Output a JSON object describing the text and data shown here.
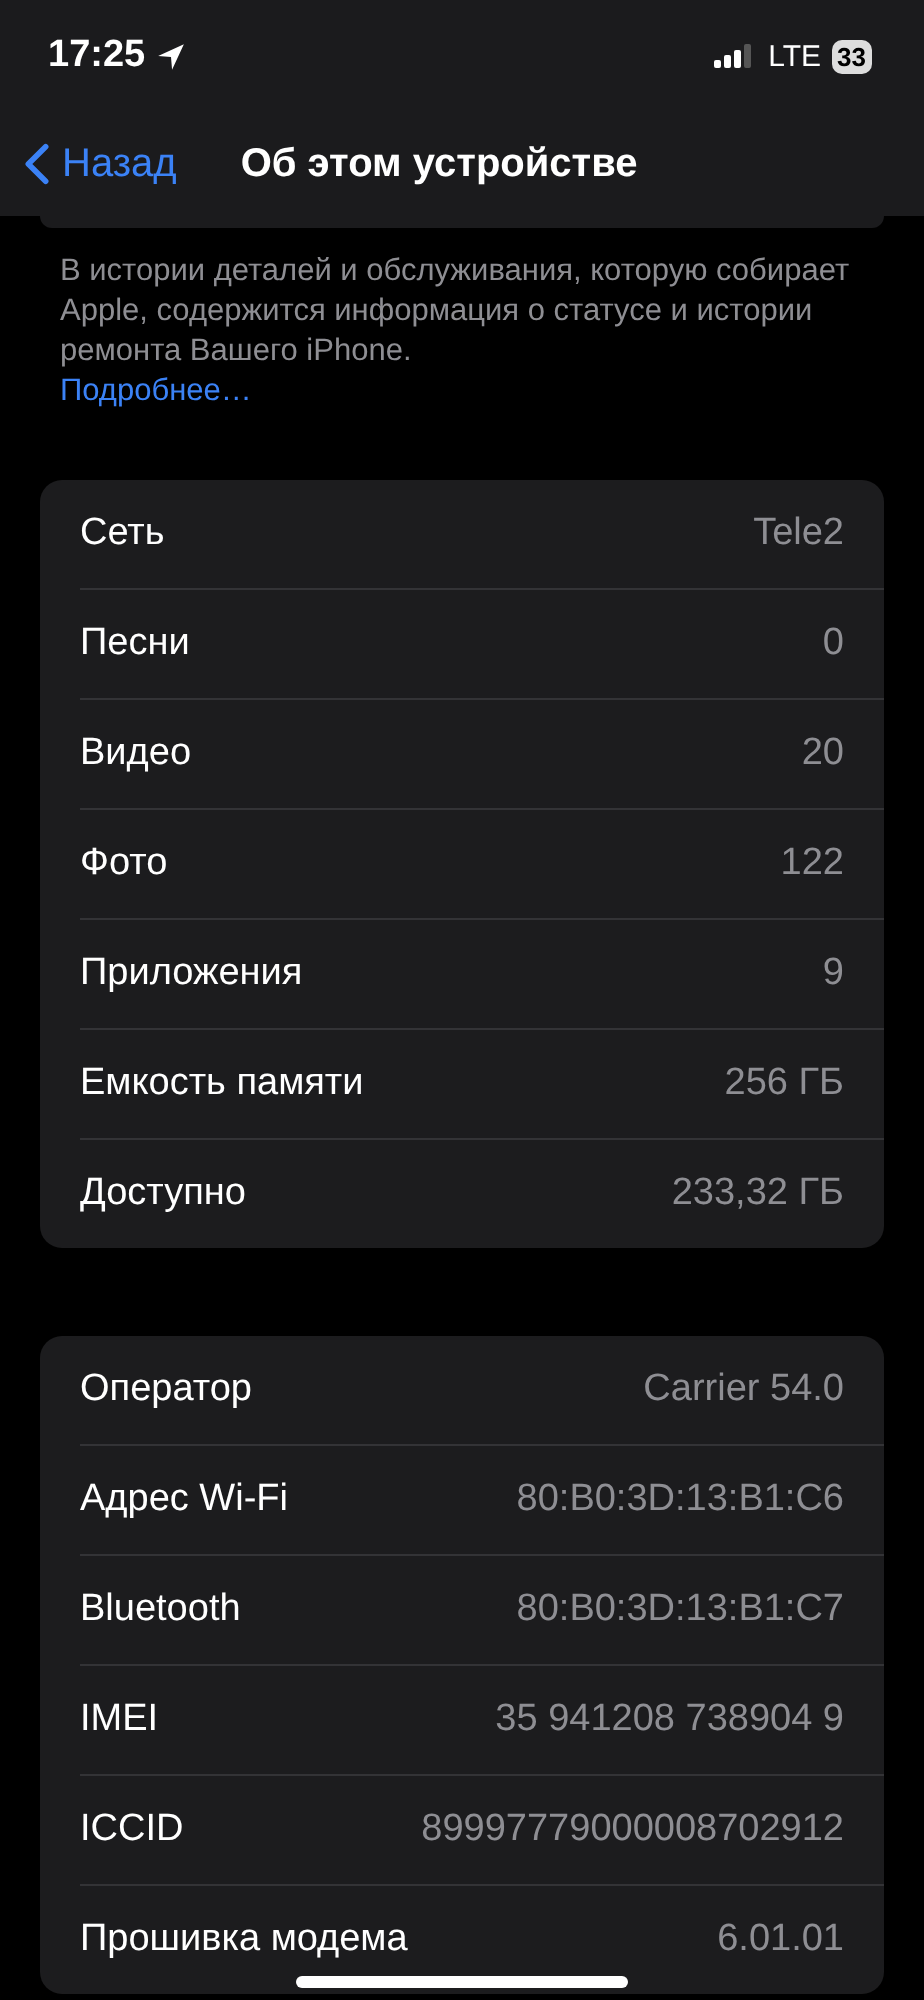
{
  "status_bar": {
    "time": "17:25",
    "network": "LTE",
    "battery": "33"
  },
  "nav": {
    "back": "Назад",
    "title": "Об этом устройстве"
  },
  "note": {
    "text": "В истории деталей и обслуживания, которую собирает Apple, содержится информация о статусе и истории ремонта Вашего iPhone.",
    "link": "Подробнее…"
  },
  "groups": [
    {
      "rows": [
        {
          "label": "Сеть",
          "value": "Tele2"
        },
        {
          "label": "Песни",
          "value": "0"
        },
        {
          "label": "Видео",
          "value": "20"
        },
        {
          "label": "Фото",
          "value": "122"
        },
        {
          "label": "Приложения",
          "value": "9"
        },
        {
          "label": "Емкость памяти",
          "value": "256 ГБ"
        },
        {
          "label": "Доступно",
          "value": "233,32 ГБ"
        }
      ]
    },
    {
      "rows": [
        {
          "label": "Оператор",
          "value": "Carrier 54.0"
        },
        {
          "label": "Адрес Wi-Fi",
          "value": "80:B0:3D:13:B1:C6"
        },
        {
          "label": "Bluetooth",
          "value": "80:B0:3D:13:B1:C7"
        },
        {
          "label": "IMEI",
          "value": "35 941208 738904 9"
        },
        {
          "label": "ICCID",
          "value": "89997779000008702912"
        },
        {
          "label": "Прошивка модема",
          "value": "6.01.01"
        }
      ]
    }
  ]
}
